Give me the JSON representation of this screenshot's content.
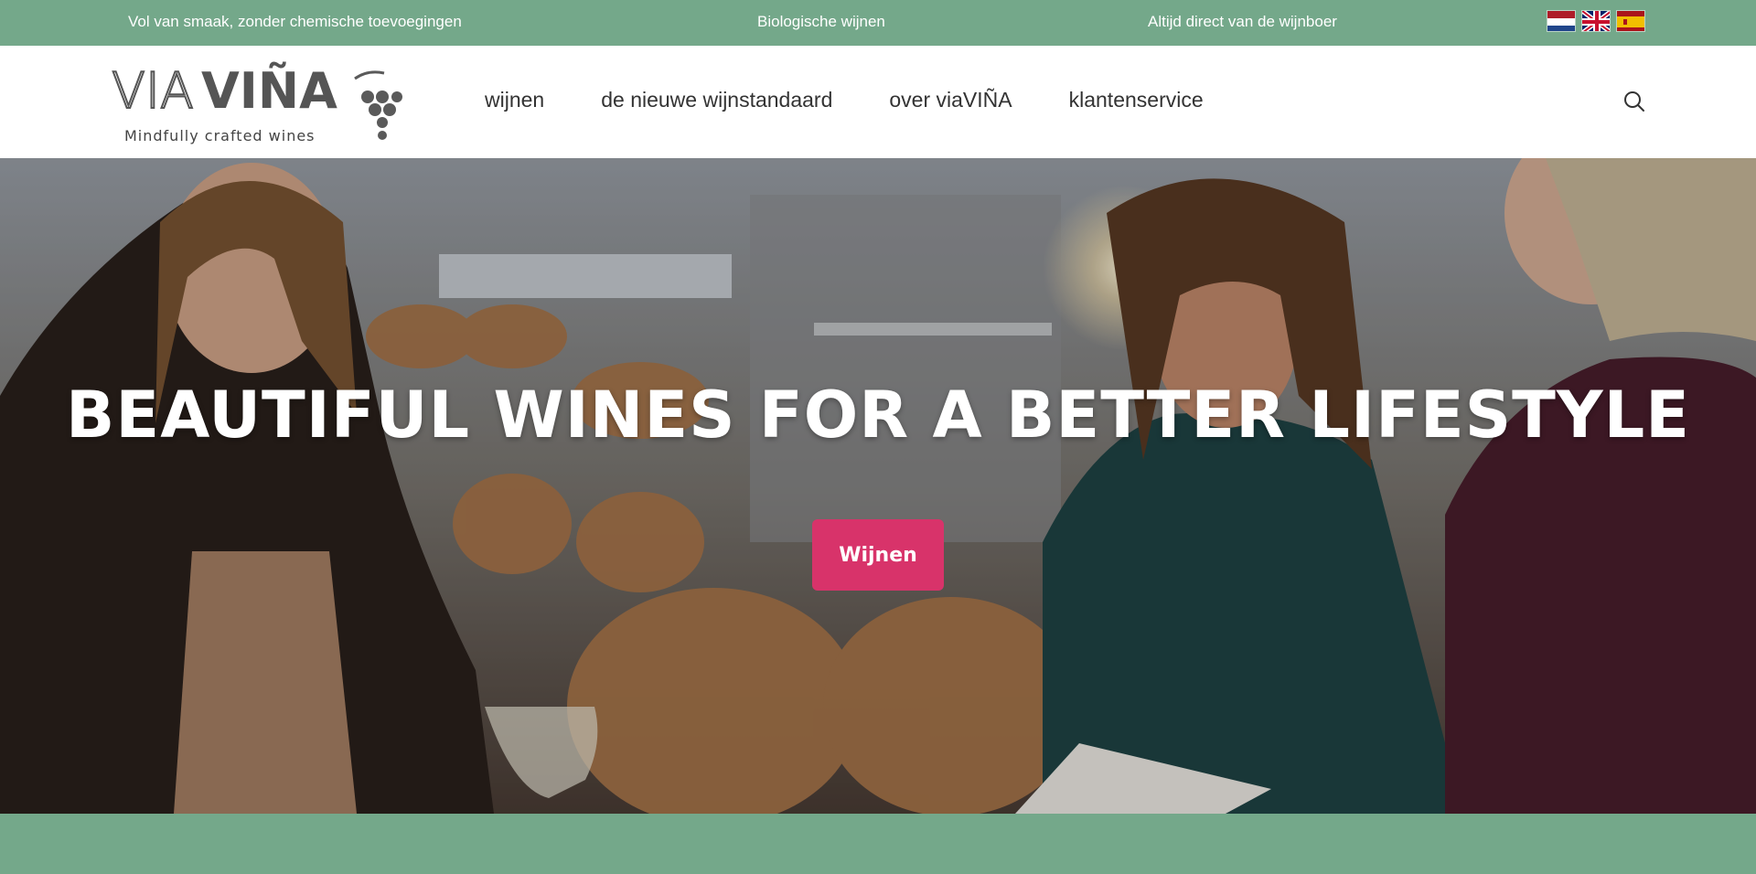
{
  "topbar": {
    "usp_1": "Vol van smaak, zonder chemische toevoegingen",
    "usp_2": "Biologische wijnen",
    "usp_3": "Altijd direct van de wijnboer",
    "background": "#74a88a",
    "flags": [
      "flag-netherlands-icon",
      "flag-uk-icon",
      "flag-spain-icon"
    ]
  },
  "header": {
    "logo_text_light": "VIA",
    "logo_text_bold": "VIÑA",
    "logo_tagline": "Mindfully crafted wines",
    "nav": [
      {
        "label": "wijnen"
      },
      {
        "label": "de nieuwe wijnstandaard"
      },
      {
        "label": "over viaVIÑA"
      },
      {
        "label": "klantenservice"
      }
    ],
    "search_icon": "search-icon"
  },
  "hero": {
    "title": "BEAUTIFUL WINES FOR A BETTER LIFESTYLE",
    "button_label": "Wijnen",
    "button_color": "#d8336a"
  },
  "colors": {
    "accent_green": "#74a88a",
    "accent_pink": "#d8336a",
    "logo_gray": "#555555",
    "logo_grape": "#5a5a5a"
  }
}
